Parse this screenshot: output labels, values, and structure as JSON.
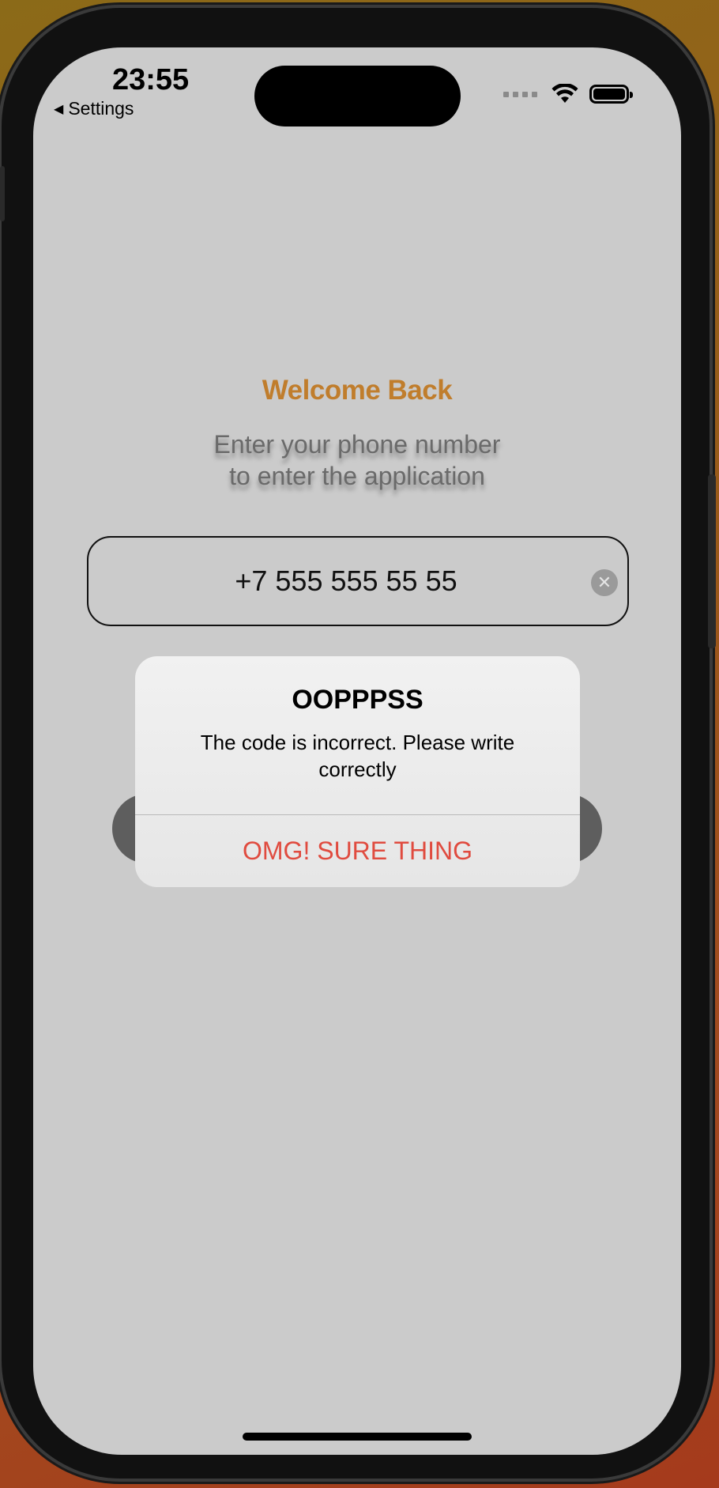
{
  "status_bar": {
    "time": "23:55",
    "back_label": "Settings",
    "back_icon": "◀"
  },
  "login": {
    "title": "Welcome Back",
    "subtitle_line1": "Enter your phone number",
    "subtitle_line2": "to enter the application",
    "phone_value": "+7 555 555 55 55",
    "clear_icon": "✕"
  },
  "alert": {
    "title": "OOPPPSS",
    "message": "The code is incorrect. Please write correctly",
    "action_label": "OMG! SURE THING"
  },
  "colors": {
    "accent_title": "#c07d2c",
    "alert_action": "#e04b3f",
    "screen_background": "#cbcbcb"
  }
}
